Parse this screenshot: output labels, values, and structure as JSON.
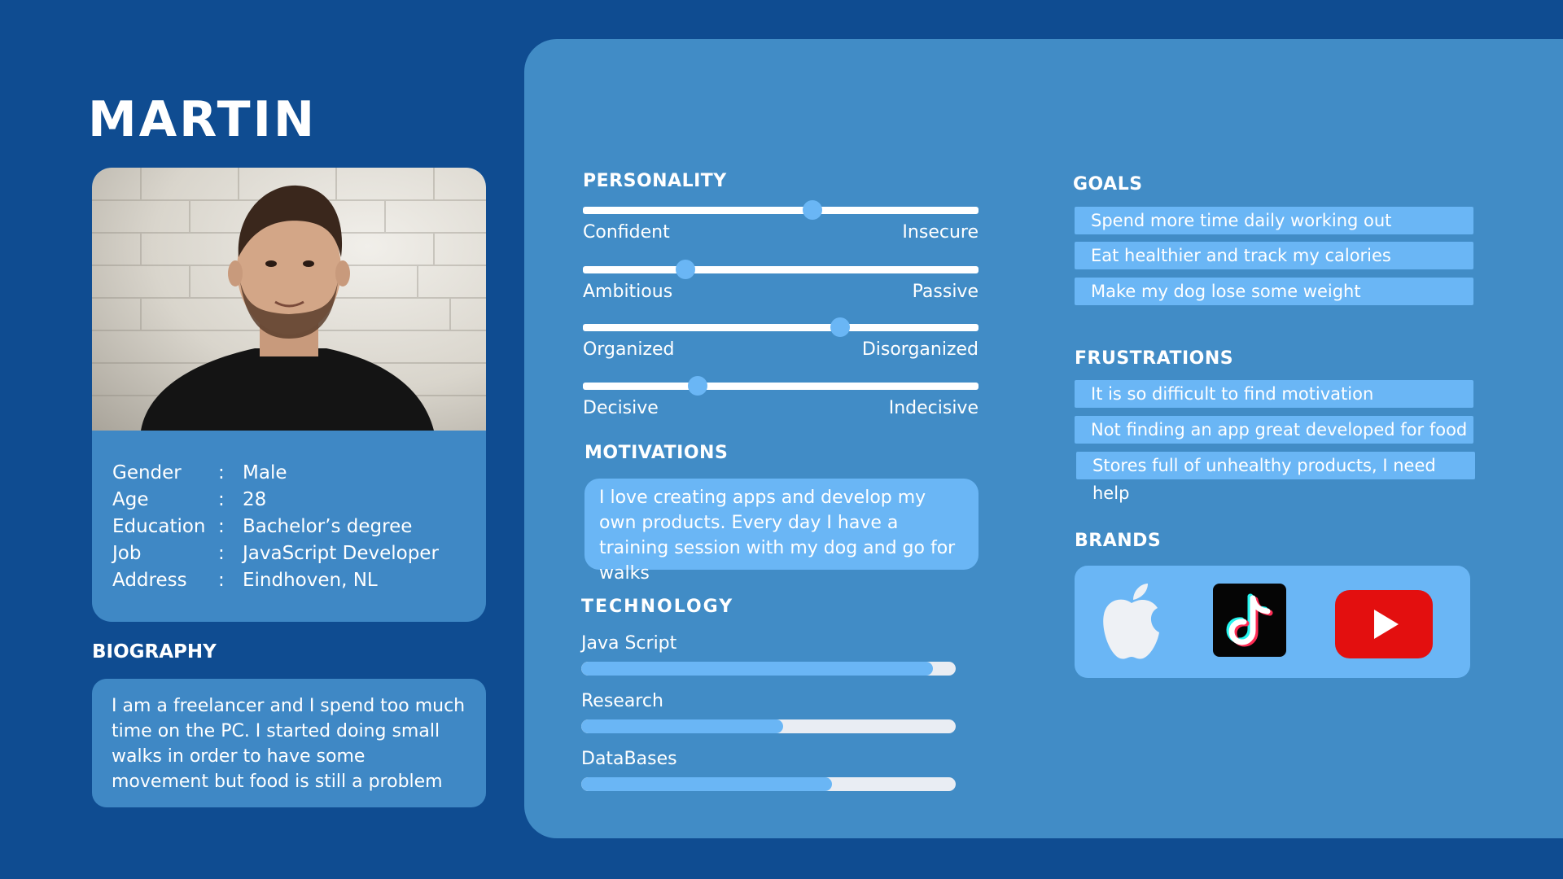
{
  "persona": {
    "name": "MARTIN"
  },
  "profile": {
    "rows": [
      {
        "label": "Gender",
        "sep": ":",
        "value": "Male"
      },
      {
        "label": "Age",
        "sep": ":",
        "value": "28"
      },
      {
        "label": "Education",
        "sep": ":",
        "value": "Bachelor’s degree"
      },
      {
        "label": "Job",
        "sep": ":",
        "value": "JavaScript Developer"
      },
      {
        "label": "Address",
        "sep": ":",
        "value": "Eindhoven, NL"
      }
    ]
  },
  "biography": {
    "heading": "BIOGRAPHY",
    "text": "I am a freelancer and I spend too much time on the PC. I started doing small walks in order to have some movement but food is still a problem"
  },
  "personality": {
    "heading": "PERSONALITY",
    "traits": [
      {
        "left": "Confident",
        "right": "Insecure",
        "level": 0.58
      },
      {
        "left": "Ambitious",
        "right": "Passive",
        "level": 0.26
      },
      {
        "left": "Organized",
        "right": "Disorganized",
        "level": 0.65
      },
      {
        "left": "Decisive",
        "right": "Indecisive",
        "level": 0.29
      }
    ]
  },
  "motivations": {
    "heading": "MOTIVATIONS",
    "text": "I love creating apps and develop my own products. Every day I have a training session with my dog and go for walks"
  },
  "technology": {
    "heading": "TECHNOLOGY",
    "skills": [
      {
        "label": "Java Script",
        "level": 0.94
      },
      {
        "label": "Research",
        "level": 0.54
      },
      {
        "label": "DataBases",
        "level": 0.67
      }
    ]
  },
  "goals": {
    "heading": "GOALS",
    "items": [
      "Spend more time daily working out",
      "Eat healthier and track my calories",
      "Make my dog lose some weight"
    ]
  },
  "frustrations": {
    "heading": "FRUSTRATIONS",
    "items": [
      "It is so difficult to find motivation",
      "Not finding an app great developed for food",
      "Stores full of unhealthy products, I need help"
    ]
  },
  "brands": {
    "heading": "BRANDS",
    "icons": [
      "apple-icon",
      "tiktok-icon",
      "youtube-icon"
    ]
  },
  "colors": {
    "background": "#0f4c91",
    "panel": "#418cc6",
    "card": "#3f88c5",
    "accent": "#6ab6f5",
    "youtube_red": "#e30f0f"
  }
}
